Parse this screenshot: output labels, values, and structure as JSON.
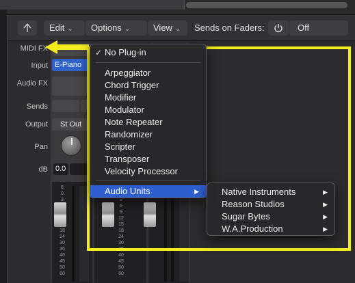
{
  "toolbar": {
    "edit_label": "Edit",
    "options_label": "Options",
    "view_label": "View",
    "sends_on_faders_label": "Sends on Faders:",
    "sends_value": "Off"
  },
  "channel": {
    "labels": [
      "MIDI FX",
      "Input",
      "Audio FX",
      "Sends",
      "Output",
      "Pan",
      "dB"
    ],
    "input_value": "E-Piano",
    "output_value": "St Out",
    "db_value": "0.0",
    "meter_scale": [
      "6",
      "0",
      "3",
      "6",
      "9",
      "12",
      "15",
      "18",
      "24",
      "30",
      "35",
      "40",
      "45",
      "50",
      "60"
    ]
  },
  "midi_fx_menu": {
    "top_item": "No Plug-in",
    "items": [
      "Arpeggiator",
      "Chord Trigger",
      "Modifier",
      "Modulator",
      "Note Repeater",
      "Randomizer",
      "Scripter",
      "Transposer",
      "Velocity Processor"
    ],
    "audio_units_label": "Audio Units"
  },
  "audio_units_menu": {
    "items": [
      "Native Instruments",
      "Reason Studios",
      "Sugar Bytes",
      "W.A.Production"
    ]
  },
  "colors": {
    "highlight": "#f4ec1c",
    "menu_selection": "#2f5fcf",
    "input_blue": "#2f63c9"
  }
}
